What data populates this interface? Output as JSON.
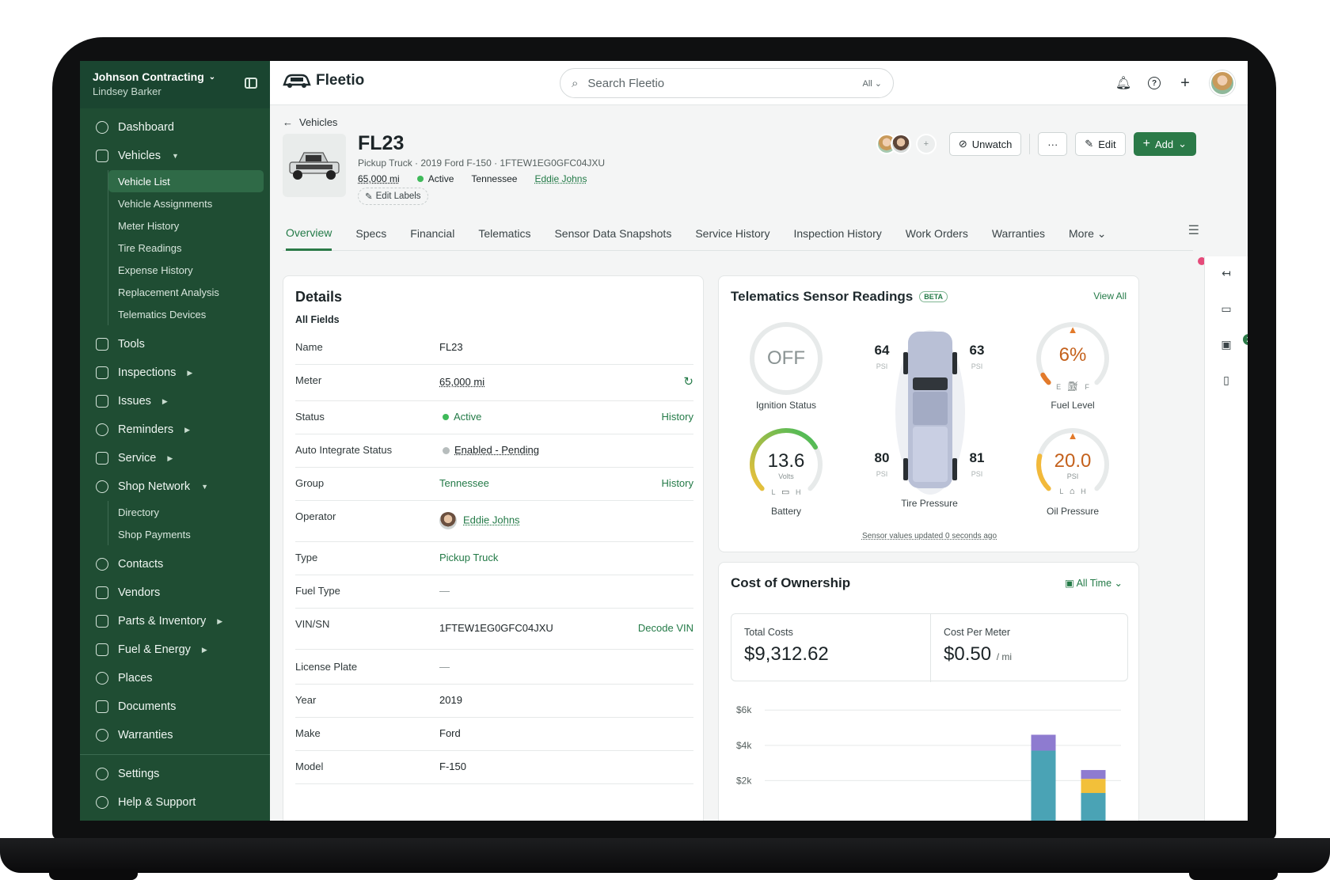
{
  "org": {
    "name": "Johnson Contracting",
    "user": "Lindsey Barker"
  },
  "nav": {
    "dashboard": "Dashboard",
    "vehicles": "Vehicles",
    "vehicle_sub": [
      "Vehicle List",
      "Vehicle Assignments",
      "Meter History",
      "Tire Readings",
      "Expense History",
      "Replacement Analysis",
      "Telematics Devices"
    ],
    "tools": "Tools",
    "inspections": "Inspections",
    "issues": "Issues",
    "reminders": "Reminders",
    "service": "Service",
    "shop_network": "Shop Network",
    "shop_sub": [
      "Directory",
      "Shop Payments"
    ],
    "contacts": "Contacts",
    "vendors": "Vendors",
    "parts": "Parts & Inventory",
    "fuel": "Fuel & Energy",
    "places": "Places",
    "documents": "Documents",
    "warranties": "Warranties",
    "settings": "Settings",
    "help": "Help & Support"
  },
  "topbar": {
    "brand": "Fleetio",
    "search_placeholder": "Search Fleetio",
    "search_scope": "All"
  },
  "header": {
    "breadcrumb": "Vehicles",
    "title": "FL23",
    "subtitle": "Pickup Truck · 2019 Ford F-150 · 1FTEW1EG0GFC04JXU",
    "meter": "65,000 mi",
    "status": "Active",
    "group": "Tennessee",
    "operator": "Eddie Johns",
    "edit_labels": "Edit Labels",
    "unwatch": "Unwatch",
    "more": "···",
    "edit": "Edit",
    "add": "Add"
  },
  "tabs": [
    "Overview",
    "Specs",
    "Financial",
    "Telematics",
    "Sensor Data Snapshots",
    "Service History",
    "Inspection History",
    "Work Orders",
    "Warranties",
    "More"
  ],
  "details": {
    "title": "Details",
    "subtitle": "All Fields",
    "rows": [
      {
        "label": "Name",
        "value": "FL23",
        "action": ""
      },
      {
        "label": "Meter",
        "value": "65,000 mi",
        "action": ""
      },
      {
        "label": "Status",
        "value": "Active",
        "action": "History"
      },
      {
        "label": "Auto Integrate Status",
        "value": "Enabled - Pending",
        "action": ""
      },
      {
        "label": "Group",
        "value": "Tennessee",
        "action": "History"
      },
      {
        "label": "Operator",
        "value": "Eddie Johns",
        "action": ""
      },
      {
        "label": "Type",
        "value": "Pickup Truck",
        "action": ""
      },
      {
        "label": "Fuel Type",
        "value": "—",
        "action": ""
      },
      {
        "label": "VIN/SN",
        "value": "1FTEW1EG0GFC04JXU",
        "action": "Decode VIN"
      },
      {
        "label": "License Plate",
        "value": "—",
        "action": ""
      },
      {
        "label": "Year",
        "value": "2019",
        "action": ""
      },
      {
        "label": "Make",
        "value": "Ford",
        "action": ""
      },
      {
        "label": "Model",
        "value": "F-150",
        "action": ""
      }
    ]
  },
  "telematics": {
    "title": "Telematics Sensor Readings",
    "beta": "BETA",
    "view_all": "View All",
    "ignition": {
      "value": "OFF",
      "label": "Ignition Status"
    },
    "fuel": {
      "value": "6%",
      "label": "Fuel Level",
      "low": "E",
      "high": "F",
      "level": 0.06
    },
    "battery": {
      "value": "13.6",
      "unit": "Volts",
      "label": "Battery",
      "low": "L",
      "high": "H",
      "level": 0.72
    },
    "oil": {
      "value": "20.0",
      "unit": "PSI",
      "label": "Oil Pressure",
      "low": "L",
      "high": "H",
      "level": 0.22
    },
    "tires": {
      "fl": "64",
      "fr": "63",
      "rl": "80",
      "rr": "81",
      "unit": "PSI",
      "label": "Tire Pressure"
    },
    "updated": "Sensor values updated 0 seconds ago"
  },
  "cost": {
    "title": "Cost of Ownership",
    "range": "All Time",
    "total_label": "Total Costs",
    "total_value": "$9,312.62",
    "per_meter_label": "Cost Per Meter",
    "per_meter_value": "$0.50",
    "per_meter_unit": "/ mi"
  },
  "chart_data": {
    "type": "bar",
    "yticks": [
      "$6k",
      "$4k",
      "$2k"
    ],
    "ylim": [
      0,
      6500
    ],
    "stacks": [
      {
        "segments": [
          {
            "value": 3700,
            "color": "#4aa3b5"
          },
          {
            "value": 900,
            "color": "#8e7bd0"
          }
        ]
      },
      {
        "segments": [
          {
            "value": 1300,
            "color": "#4aa3b5"
          },
          {
            "value": 800,
            "color": "#f2c03a"
          },
          {
            "value": 500,
            "color": "#8e7bd0"
          }
        ]
      }
    ]
  },
  "colors": {
    "brand": "#2b7a48",
    "sidebar": "#1f4d33",
    "warning": "#e27a2b"
  }
}
